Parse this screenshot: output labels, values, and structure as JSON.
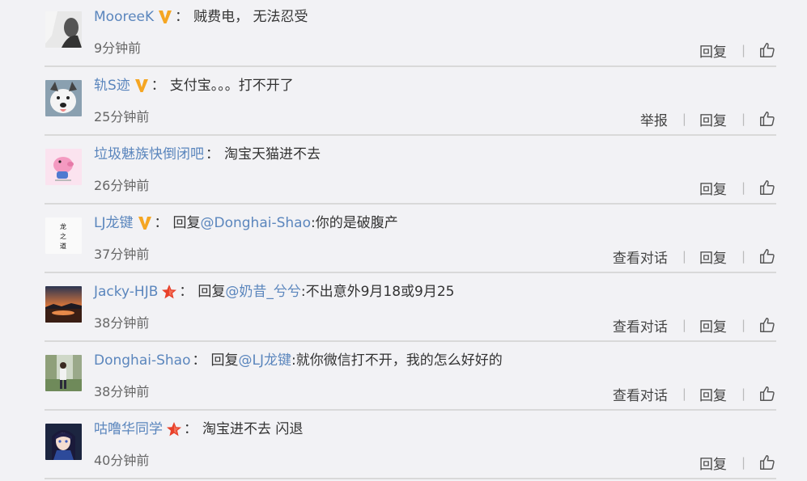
{
  "comments": [
    {
      "name": "MooreeK",
      "badge": "v",
      "colon": "：",
      "text": "贼费电， 无法忍受",
      "time": "9分钟前",
      "actions": [
        "回复"
      ],
      "avatar": "bw-portrait"
    },
    {
      "name": "轨S迹",
      "badge": "v",
      "colon": "：",
      "text": "支付宝。。。打不开了",
      "time": "25分钟前",
      "actions": [
        "举报",
        "回复"
      ],
      "avatar": "husky-dog"
    },
    {
      "name": "垃圾魅族快倒闭吧",
      "badge": "",
      "colon": "：",
      "text": "淘宝天猫进不去",
      "time": "26分钟前",
      "actions": [
        "回复"
      ],
      "avatar": "pink-cartoon-pig"
    },
    {
      "name": "LJ龙键",
      "badge": "v",
      "colon": "：",
      "reply_prefix": "回复",
      "mention": "@Donghai-Shao",
      "text": ":你的是破腹产",
      "time": "37分钟前",
      "actions": [
        "查看对话",
        "回复"
      ],
      "avatar": "calligraphy"
    },
    {
      "name": "Jacky-HJB",
      "badge": "star",
      "colon": "：",
      "reply_prefix": "回复",
      "mention": "@奶昔_兮兮",
      "text": ":不出意外9月18或9月25",
      "time": "38分钟前",
      "actions": [
        "查看对话",
        "回复"
      ],
      "avatar": "sunset-landscape"
    },
    {
      "name": "Donghai-Shao",
      "badge": "",
      "colon": "：",
      "reply_prefix": "回复",
      "mention": "@LJ龙键",
      "text": ":就你微信打不开，我的怎么好好的",
      "time": "38分钟前",
      "actions": [
        "查看对话",
        "回复"
      ],
      "avatar": "person-outdoors"
    },
    {
      "name": "咕噜华同学",
      "badge": "star",
      "colon": "：",
      "text": "淘宝进不去 闪退",
      "time": "40分钟前",
      "actions": [
        "回复"
      ],
      "avatar": "anime-girl"
    }
  ],
  "colors": {
    "link": "#5b86bd",
    "v_badge": "#f5a623",
    "star_badge": "#e8402a",
    "divider": "#d9d9d9"
  },
  "icons": {
    "like": "thumbs-up-icon",
    "v": "verified-v-icon",
    "star": "member-star-icon"
  }
}
